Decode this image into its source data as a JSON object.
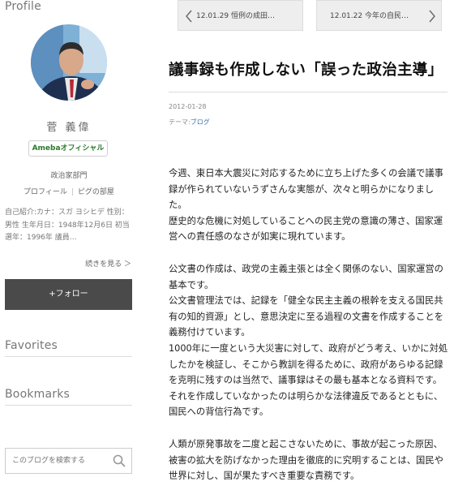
{
  "sidebar": {
    "profile_heading": "Profile",
    "name": "菅 義偉",
    "badge": "Amebaオフィシャル",
    "department": "政治家部門",
    "links": [
      "プロフィール",
      "ピグの部屋"
    ],
    "intro": "自己紹介:カナ：スガ ヨシヒデ 性別：男性 生年月日：1948年12月6日 初当選年：1996年 議員…",
    "more": "続きを見る ＞",
    "follow": "+フォロー",
    "favorites_heading": "Favorites",
    "bookmarks_heading": "Bookmarks",
    "search_placeholder": "このブログを検索する"
  },
  "nav": {
    "prev": "12.01.29 恒例の成田…",
    "next": "12.01.22 今年の自民…"
  },
  "article": {
    "title": "議事録も作成しない「誤った政治主導」",
    "date": "2012-01-28",
    "theme_label": "テーマ:",
    "theme": "ブログ",
    "paragraphs": [
      "今週、東日本大震災に対応するために立ち上げた多くの会議で議事録が作られていないうずさんな実態が、次々と明らかになりました。\n歴史的な危機に対処していることへの民主党の意識の薄さ、国家運営への責任感のなさが如実に現れています。",
      "公文書の作成は、政党の主義主張とは全く関係のない、国家運営の基本です。\n公文書管理法では、記録を「健全な民主主義の根幹を支える国民共有の知的資源」とし、意思決定に至る過程の文書を作成することを義務付けています。\n1000年に一度という大災害に対して、政府がどう考え、いかに対処したかを検証し、そこから教訓を得るために、政府があらゆる記録を克明に残すのは当然で、議事録はその最も基本となる資料です。\nそれを作成していなかったのは明らかな法律違反であるとともに、国民への背信行為です。",
      "人類が原発事故を二度と起こさないために、事故が起こった原因、被害の拡大を防げなかった理由を徹底的に究明することは、国民や世界に対し、国が果たすべき重要な責務です。"
    ]
  },
  "colors": {
    "follow_bg": "#4a4a4a",
    "badge_text": "#2b7a2b",
    "theme_link": "#3b6ea8"
  }
}
